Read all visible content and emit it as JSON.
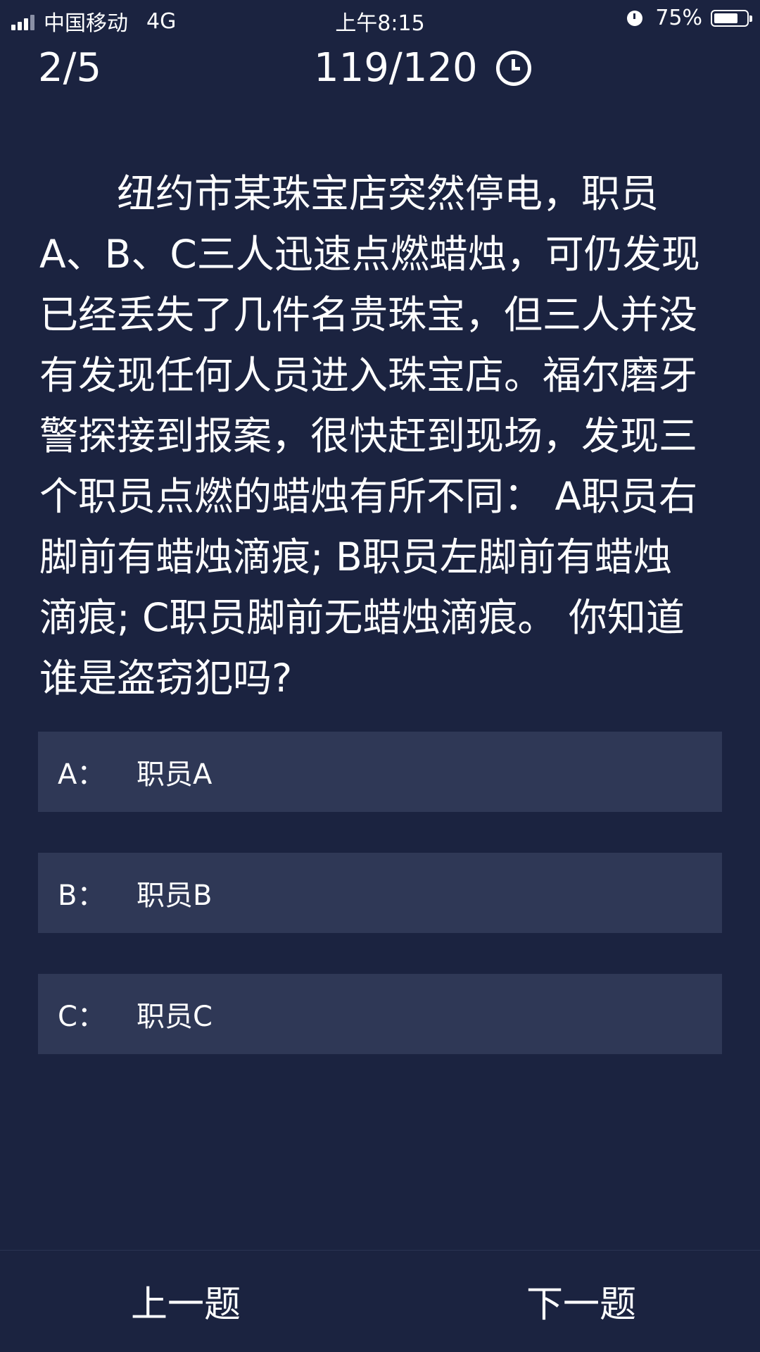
{
  "status_bar": {
    "carrier": "中国移动",
    "network": "4G",
    "time": "上午8:15",
    "battery_percent": "75%",
    "battery_level": 0.75,
    "icons": [
      "signal-icon",
      "alarm-icon",
      "battery-icon"
    ]
  },
  "header": {
    "question_progress": "2/5",
    "timer": "119/120",
    "timer_icon": "clock-icon"
  },
  "question": {
    "text": "纽约市某珠宝店突然停电，职员A、B、C三人迅速点燃蜡烛，可仍发现已经丢失了几件名贵珠宝，但三人并没有发现任何人员进入珠宝店。福尔磨牙警探接到报案，很快赶到现场，发现三个职员点燃的蜡烛有所不同： A职员右脚前有蜡烛滴痕; B职员左脚前有蜡烛滴痕; C职员脚前无蜡烛滴痕。 你知道谁是盗窃犯吗?"
  },
  "options": [
    {
      "letter": "A：",
      "text": "职员A"
    },
    {
      "letter": "B：",
      "text": "职员B"
    },
    {
      "letter": "C：",
      "text": "职员C"
    }
  ],
  "footer": {
    "prev_label": "上一题",
    "next_label": "下一题"
  },
  "colors": {
    "background": "#1b2340",
    "option_background": "#2f3856",
    "text": "#ffffff"
  }
}
